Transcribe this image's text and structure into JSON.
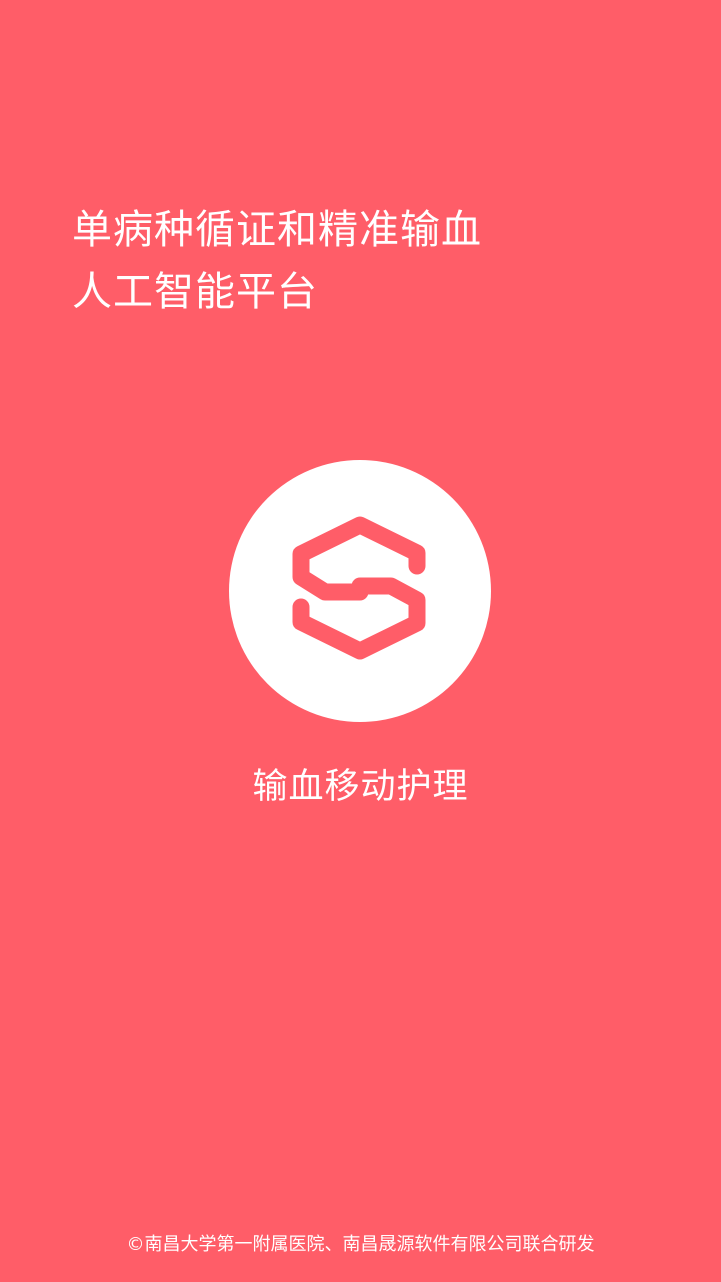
{
  "theme": {
    "background": "#FF5D68",
    "foreground": "#FFFFFF"
  },
  "headline": {
    "line1": "单病种循证和精准输血",
    "line2": "人工智能平台"
  },
  "logo": {
    "icon": "hexagon-s-logo-icon"
  },
  "app_name": "输血移动护理",
  "footer": "©南昌大学第一附属医院、南昌晟源软件有限公司联合研发"
}
